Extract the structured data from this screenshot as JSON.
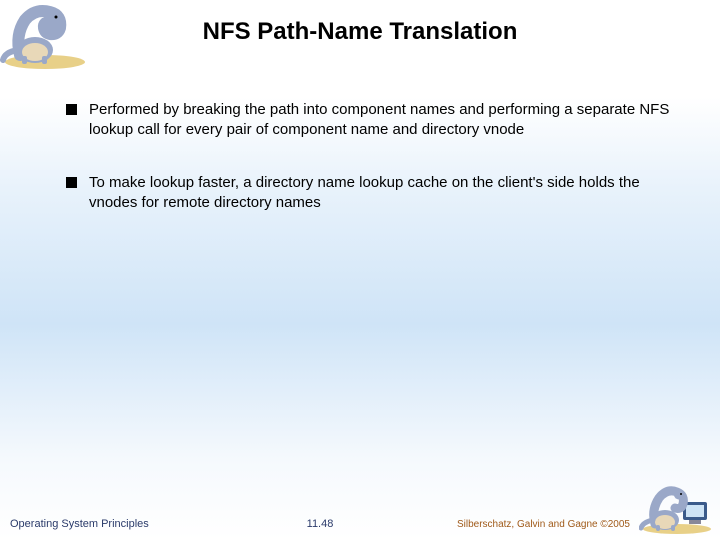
{
  "title": "NFS Path-Name Translation",
  "bullets": [
    "Performed by breaking the path into component names and performing a separate NFS lookup call for every pair of component name and directory vnode",
    "To make lookup faster, a directory name lookup cache on the client's side holds the vnodes for remote directory names"
  ],
  "footer": {
    "left": "Operating System Principles",
    "center": "11.48",
    "right": "Silberschatz, Galvin and Gagne ©2005"
  },
  "colors": {
    "dino_body": "#9aa8c8",
    "dino_belly": "#e8d8b8",
    "sand": "#e8d088",
    "monitor": "#3a5a8a"
  }
}
